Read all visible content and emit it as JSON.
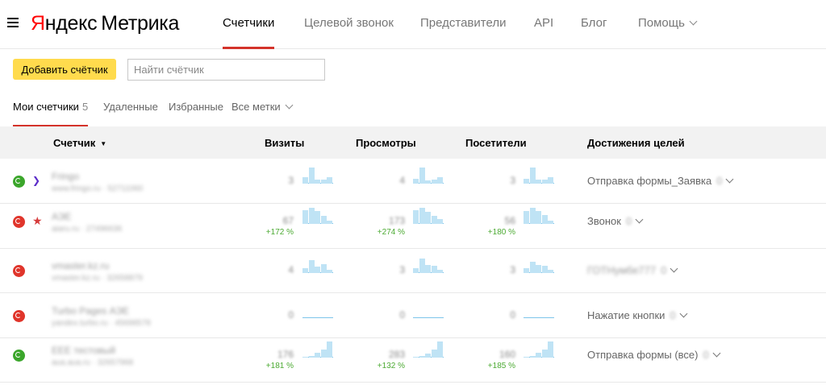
{
  "header": {
    "logo_ya": "Я",
    "logo_ndex": "ндекс",
    "logo_product": "Метрика",
    "nav": [
      {
        "label": "Счетчики",
        "active": true
      },
      {
        "label": "Целевой звонок",
        "active": false
      },
      {
        "label": "Представители",
        "active": false
      },
      {
        "label": "API",
        "active": false
      },
      {
        "label": "Блог",
        "active": false
      },
      {
        "label": "Помощь",
        "active": false
      }
    ]
  },
  "toolbar": {
    "add_button": "Добавить счётчик",
    "search_placeholder": "Найти счётчик"
  },
  "tabs": {
    "mine": "Мои счетчики",
    "mine_count": "5",
    "deleted": "Удаленные",
    "favorites": "Избранные",
    "all_tags": "Все метки"
  },
  "table": {
    "columns": {
      "counter": "Счетчик",
      "visits": "Визиты",
      "views": "Просмотры",
      "visitors": "Посетители",
      "goals": "Достижения целей"
    },
    "rows": [
      {
        "status": "green",
        "badge": "arrow",
        "name": "Fringo",
        "sub": "www.fringo.ru · 52711060",
        "visits": "3",
        "visits_pct": "",
        "views": "4",
        "views_pct": "",
        "visitors": "3",
        "visitors_pct": "",
        "goal": "Отправка формы_Заявка",
        "goal_count": "0",
        "goal_blurred": false,
        "sparks": [
          [
            0.4,
            1,
            0.25,
            0.25,
            0.4
          ],
          [
            0.3,
            1,
            0.2,
            0.25,
            0.4
          ],
          [
            0.3,
            1,
            0.25,
            0.25,
            0.4
          ]
        ]
      },
      {
        "status": "red",
        "badge": "star",
        "name": "АЭЕ",
        "sub": "aiaru.ru · 27496636",
        "visits": "67",
        "visits_pct": "+172 %",
        "views": "173",
        "views_pct": "+274 %",
        "visitors": "56",
        "visitors_pct": "+180 %",
        "goal": "Звонок",
        "goal_count": "0",
        "goal_blurred": false,
        "sparks": [
          [
            0.85,
            1,
            0.8,
            0.5,
            0.2
          ],
          [
            0.85,
            1,
            0.75,
            0.5,
            0.3
          ],
          [
            0.8,
            1,
            0.8,
            0.55,
            0.2
          ]
        ]
      },
      {
        "status": "red",
        "badge": "",
        "name": "vmaster.kz.ru",
        "sub": "vmaster.kz.ru · 32658879",
        "visits": "4",
        "visits_pct": "",
        "views": "3",
        "views_pct": "",
        "visitors": "3",
        "visitors_pct": "",
        "goal": "ГОТНумбе777",
        "goal_count": "0",
        "goal_blurred": true,
        "sparks": [
          [
            0.3,
            0.8,
            0.4,
            0.55,
            0.2
          ],
          [
            0.3,
            0.9,
            0.5,
            0.45,
            0.2
          ],
          [
            0.3,
            0.7,
            0.5,
            0.45,
            0.2
          ]
        ]
      },
      {
        "status": "red",
        "badge": "",
        "name": "Turbo Pages АЭЕ",
        "sub": "yandex.turbo.ru · 45698578",
        "visits": "0",
        "visits_pct": "",
        "views": "0",
        "views_pct": "",
        "visitors": "0",
        "visitors_pct": "",
        "goal": "Нажатие кнопки",
        "goal_count": "0",
        "goal_blurred": false,
        "sparks": [
          [],
          [],
          []
        ]
      },
      {
        "status": "green",
        "badge": "",
        "name": "ЕЕЕ тестовый",
        "sub": "aua.aua.ru · 32657968",
        "visits": "176",
        "visits_pct": "+181 %",
        "views": "283",
        "views_pct": "+132 %",
        "visitors": "160",
        "visitors_pct": "+185 %",
        "goal": "Отправка формы (все)",
        "goal_count": "0",
        "goal_blurred": false,
        "sparks": [
          [
            0.05,
            0.1,
            0.3,
            0.5,
            1
          ],
          [
            0.05,
            0.1,
            0.25,
            0.5,
            1
          ],
          [
            0.05,
            0.1,
            0.3,
            0.5,
            1
          ]
        ]
      }
    ]
  },
  "colors": {
    "accent_red": "#d4332a",
    "button_yellow": "#ffdb4d",
    "status_green": "#3ba62b",
    "status_red": "#e0352b",
    "growth_green": "#4caa33",
    "spark_fill": "#bfe3f5"
  }
}
